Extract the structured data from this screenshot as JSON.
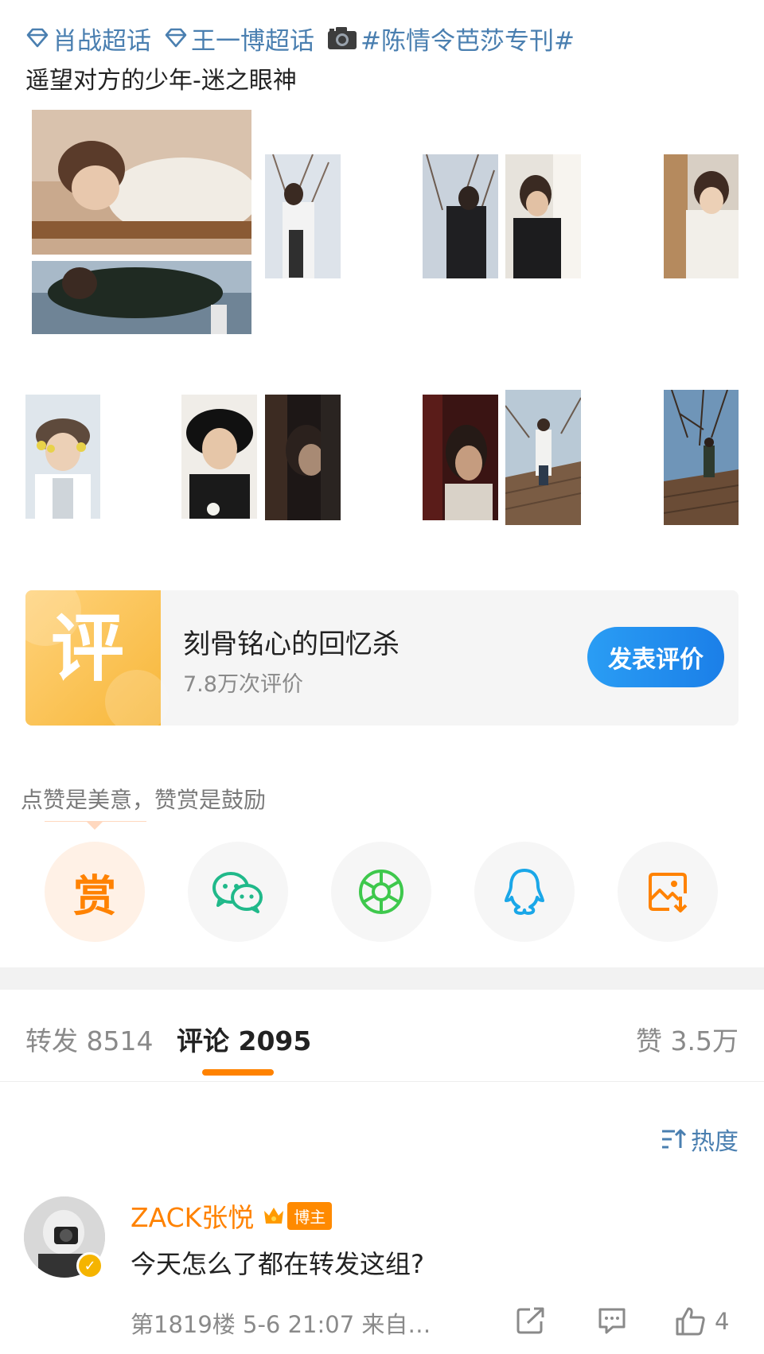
{
  "post": {
    "topics": [
      {
        "label": "肖战超话",
        "icon": "diamond-icon"
      },
      {
        "label": "王一博超话",
        "icon": "diamond-icon"
      },
      {
        "label": "#陈情令芭莎专刊#",
        "icon": "camera-icon"
      }
    ],
    "text": "遥望对方的少年-迷之眼神"
  },
  "review": {
    "badge_glyph": "评",
    "title": "刻骨铭心的回忆杀",
    "count": "7.8万次评价",
    "button": "发表评价"
  },
  "share": {
    "tip": "点赞是美意，赞赏是鼓励",
    "reward_glyph": "赏",
    "items": [
      "reward-icon",
      "wechat-icon",
      "moments-icon",
      "qq-icon",
      "save-image-icon"
    ]
  },
  "tabs": {
    "forward": "转发 8514",
    "comment": "评论 2095",
    "like": "赞 3.5万"
  },
  "sort": {
    "label": "热度"
  },
  "comment": {
    "user": "ZACK张悦",
    "badge": "博主",
    "text": "今天怎么了都在转发这组?",
    "meta": "第1819楼  5-6 21:07  来自…",
    "likes": "4"
  },
  "colors": {
    "accent": "#ff8200",
    "link": "#4a7fb0",
    "button_blue": "#1b7fe8",
    "wechat": "#20b98a",
    "moments": "#3ec84c",
    "qq": "#1aa7e8"
  }
}
